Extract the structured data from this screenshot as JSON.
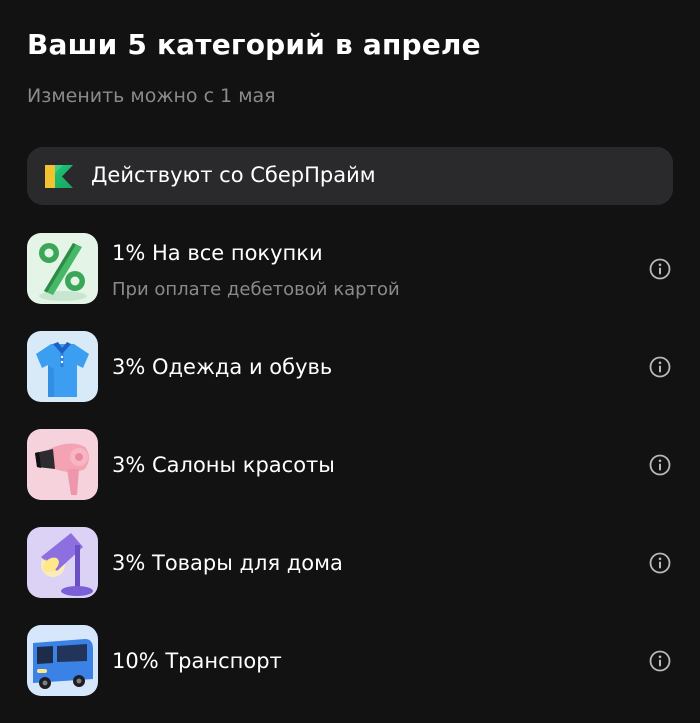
{
  "header": {
    "title": "Ваши 5 категорий в апреле",
    "subtitle": "Изменить можно с 1 мая"
  },
  "banner": {
    "icon": "sberprime-logo-icon",
    "label": "Действуют со СберПрайм"
  },
  "categories": [
    {
      "icon": "percent-icon",
      "title": "1% На все покупки",
      "subtitle": "При оплате дебетовой картой"
    },
    {
      "icon": "polo-shirt-icon",
      "title": "3% Одежда и обувь"
    },
    {
      "icon": "hair-dryer-icon",
      "title": "3% Салоны красоты"
    },
    {
      "icon": "desk-lamp-icon",
      "title": "3% Товары для дома"
    },
    {
      "icon": "bus-icon",
      "title": "10% Транспорт"
    }
  ],
  "colors": {
    "background": "#121212",
    "banner_background": "#2a2a2c",
    "secondary_text": "#8a8a8e",
    "info_icon": "#b9b9bd",
    "tile_percent": "#e4f4e7",
    "tile_clothes": "#d8eaf8",
    "tile_beauty": "#f6d3dc",
    "tile_home": "#dcd2f6",
    "tile_transport": "#d6e6fb"
  }
}
